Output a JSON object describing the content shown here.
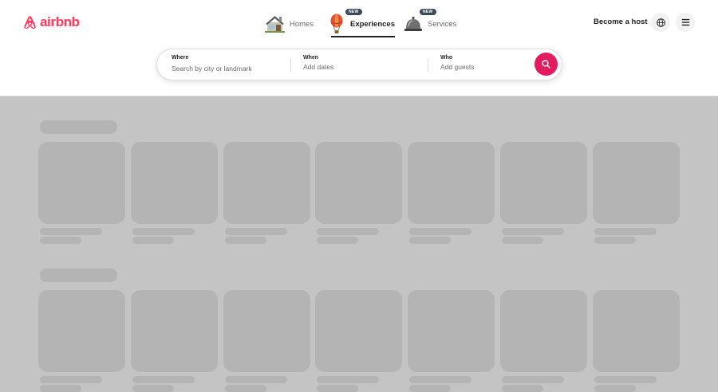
{
  "brand": {
    "name": "airbnb",
    "color": "#ff385c"
  },
  "nav": {
    "tabs": [
      {
        "label": "Homes",
        "icon": "house-icon",
        "badge": "",
        "active": false
      },
      {
        "label": "Experiences",
        "icon": "hot-air-balloon-icon",
        "badge": "NEW",
        "active": true
      },
      {
        "label": "Services",
        "icon": "service-bell-icon",
        "badge": "NEW",
        "active": false
      }
    ],
    "become_host": "Become a host",
    "globe_icon": "globe-icon",
    "menu_icon": "hamburger-menu-icon"
  },
  "search": {
    "where_label": "Where",
    "where_placeholder": "Search by city or landmark",
    "when_label": "When",
    "when_value": "Add dates",
    "who_label": "Who",
    "who_value": "Add guests",
    "button_icon": "search-icon",
    "button_color": "#e31c5f"
  },
  "content": {
    "state": "loading",
    "sections": 2,
    "cards_per_row": 7,
    "skeleton_color": "#b4b4b4",
    "overlay_color": "#c4c4c4"
  }
}
